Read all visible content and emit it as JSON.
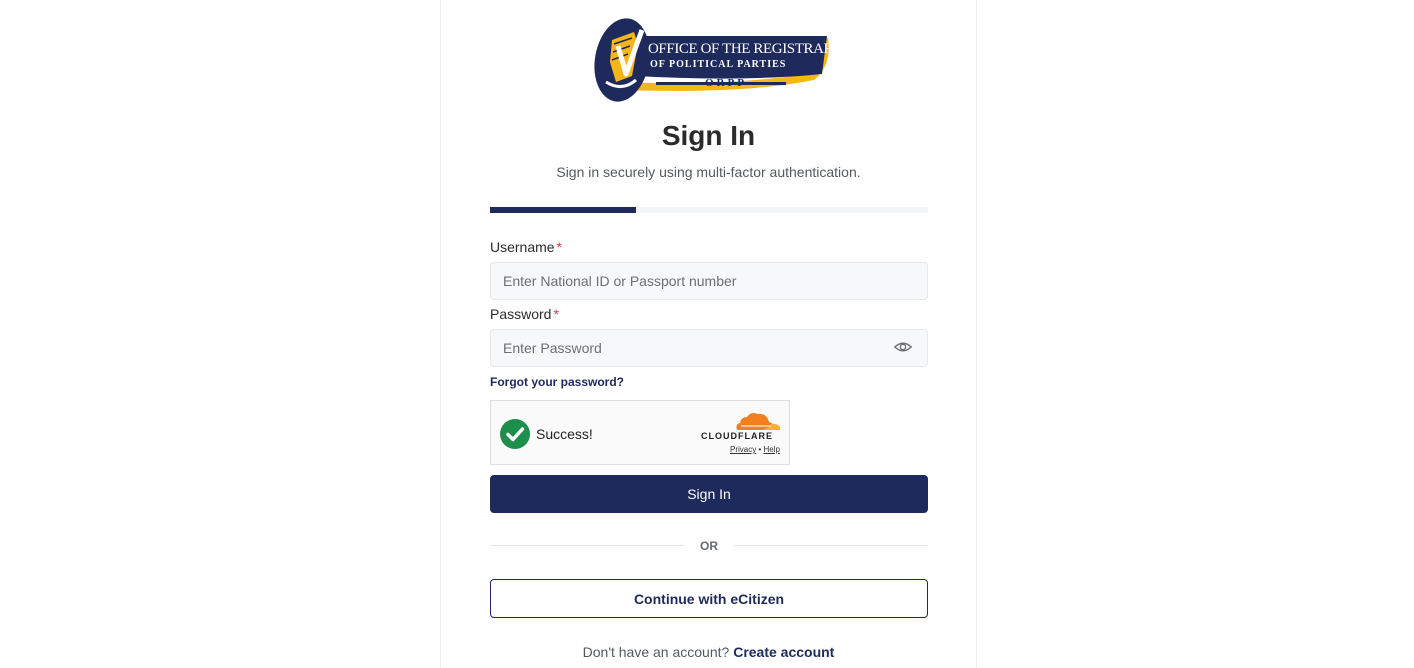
{
  "logo": {
    "line1": "OFFICE OF THE REGISTRAR",
    "line2": "OF POLITICAL PARTIES",
    "line3": "ORPP",
    "navy": "#1f2a5c",
    "gold": "#f5b616"
  },
  "header": {
    "title": "Sign In",
    "subtitle": "Sign in securely using multi-factor authentication."
  },
  "progress": {
    "fraction": 0.333
  },
  "form": {
    "username_label": "Username",
    "username_placeholder": "Enter National ID or Passport number",
    "password_label": "Password",
    "password_placeholder": "Enter Password",
    "required_mark": "*",
    "forgot_link": "Forgot your password?"
  },
  "captcha": {
    "status": "Success!",
    "brand": "CLOUDFLARE",
    "privacy": "Privacy",
    "separator": "•",
    "help": "Help"
  },
  "actions": {
    "sign_in": "Sign In",
    "or": "OR",
    "ecitizen": "Continue with eCitizen"
  },
  "footer": {
    "prompt": "Don't have an account?",
    "create": "Create account"
  },
  "colors": {
    "primary": "#1f2a5c",
    "required": "#dc3545",
    "success": "#1e8e4d",
    "cloudflare_orange": "#f38020"
  }
}
